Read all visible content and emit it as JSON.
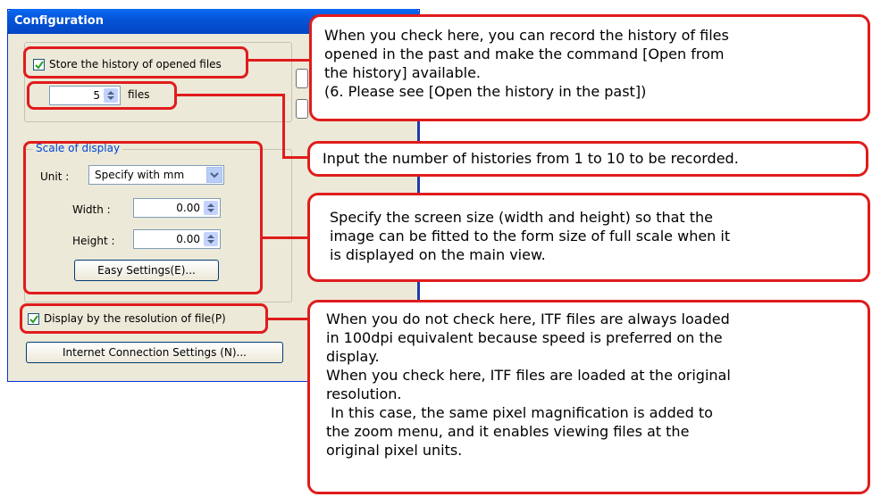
{
  "window": {
    "title": "Configuration"
  },
  "history": {
    "store_label": "Store the history of opened files",
    "store_checked": true,
    "count_value": "5",
    "count_unit": "files"
  },
  "scale": {
    "group_label": "Scale of display",
    "unit_label": "Unit :",
    "unit_value": "Specify with mm",
    "width_label": "Width :",
    "width_value": "0.00",
    "height_label": "Height :",
    "height_value": "0.00",
    "easy_button": "Easy Settings(E)..."
  },
  "display": {
    "resolution_label": "Display by the resolution of file(P)",
    "resolution_checked": true
  },
  "internet_button": "Internet Connection Settings (N)...",
  "callouts": {
    "history": "When you check here, you can record the history of files\nopened in the past and make the command [Open from\nthe history] available.\n(6. Please see [Open the history in the past])",
    "count": "Input the number of histories from 1 to 10 to be recorded.",
    "scale": "Specify the screen size (width and height) so that the\nimage can be fitted to the form size of full scale when it\nis displayed on the main view.",
    "resolution": "When you do not check here, ITF files are always loaded\nin 100dpi equivalent because speed is preferred on the\ndisplay.\nWhen you check here, ITF files are loaded at the original\nresolution.\n In this case, the same pixel magnification is added to\nthe zoom menu, and it enables viewing files at the\noriginal pixel units."
  },
  "colors": {
    "highlight": "#e01c1c",
    "titlebar": "#0453d6"
  }
}
